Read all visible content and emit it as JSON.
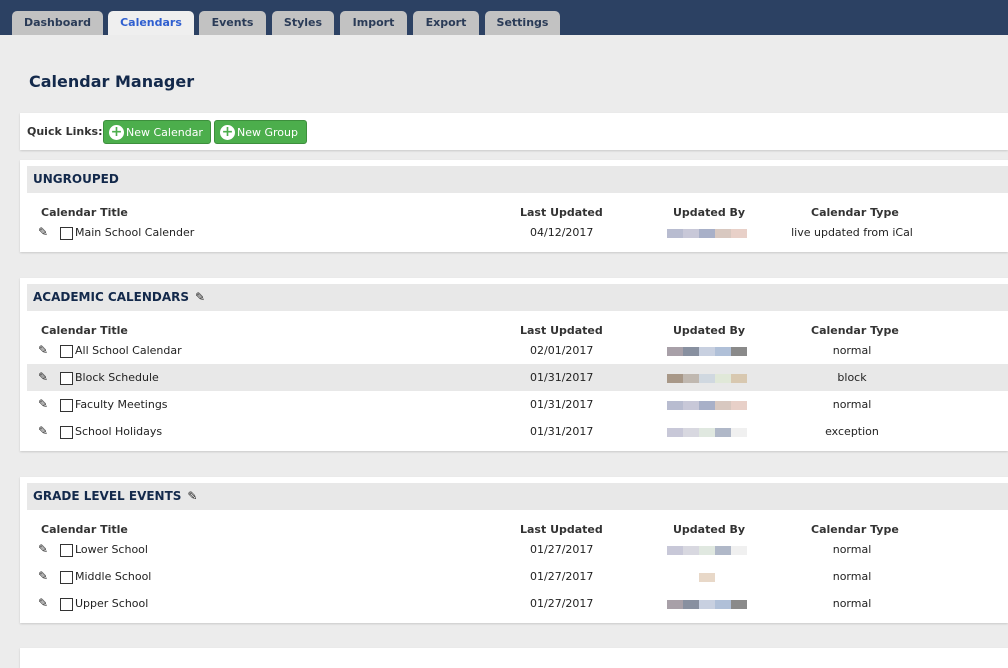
{
  "tabs": [
    {
      "label": "Dashboard"
    },
    {
      "label": "Calendars",
      "active": true
    },
    {
      "label": "Events"
    },
    {
      "label": "Styles"
    },
    {
      "label": "Import"
    },
    {
      "label": "Export"
    },
    {
      "label": "Settings"
    }
  ],
  "page_title": "Calendar Manager",
  "quick_links": {
    "label": "Quick Links:",
    "new_calendar": "New Calendar",
    "new_group": "New Group"
  },
  "columns": {
    "title": "Calendar Title",
    "last_updated": "Last Updated",
    "updated_by": "Updated By",
    "type": "Calendar Type"
  },
  "groups": [
    {
      "name": "UNGROUPED",
      "editable": false,
      "rows": [
        {
          "title": "Main School Calender",
          "date": "04/12/2017",
          "type": "live updated from iCal"
        }
      ]
    },
    {
      "name": "ACADEMIC CALENDARS",
      "editable": true,
      "rows": [
        {
          "title": "All School Calendar",
          "date": "02/01/2017",
          "type": "normal"
        },
        {
          "title": "Block Schedule",
          "date": "01/31/2017",
          "type": "block"
        },
        {
          "title": "Faculty Meetings",
          "date": "01/31/2017",
          "type": "normal"
        },
        {
          "title": "School Holidays",
          "date": "01/31/2017",
          "type": "exception"
        }
      ]
    },
    {
      "name": "GRADE LEVEL EVENTS",
      "editable": true,
      "rows": [
        {
          "title": "Lower School",
          "date": "01/27/2017",
          "type": "normal"
        },
        {
          "title": "Middle School",
          "date": "01/27/2017",
          "type": "normal"
        },
        {
          "title": "Upper School",
          "date": "01/27/2017",
          "type": "normal"
        }
      ]
    }
  ]
}
